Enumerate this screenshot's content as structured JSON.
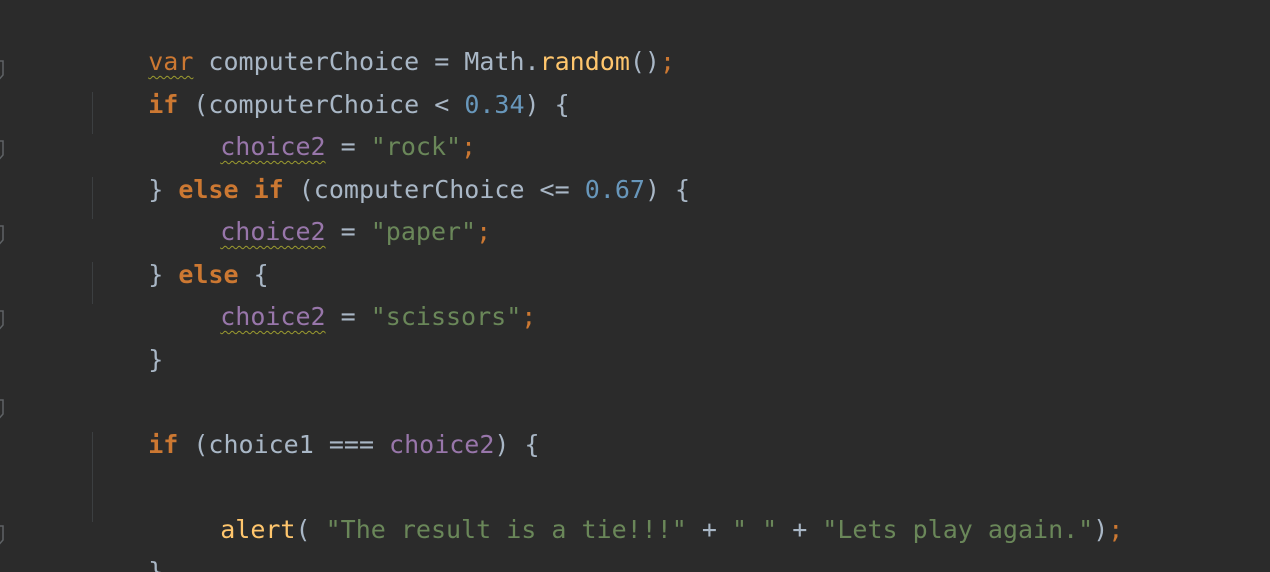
{
  "editor": {
    "theme_colors": {
      "background": "#2b2b2b",
      "keyword": "#cc7832",
      "number": "#6897bb",
      "string": "#6a8759",
      "variable": "#9876aa",
      "function": "#ffc66d",
      "plain": "#a9b7c6"
    },
    "code": {
      "l1_kw": "var",
      "l1_name": " computerChoice = Math.",
      "l1_fn": "random",
      "l1_tail": "()",
      "l1_semi": ";",
      "l2_kw": "if",
      "l2_open": " (computerChoice < ",
      "l2_num": "0.34",
      "l2_close": ") {",
      "l3_var": "choice2",
      "l3_eq": " = ",
      "l3_str": "\"rock\"",
      "l3_semi": ";",
      "l4_brace": "} ",
      "l4_kw": "else if",
      "l4_open": " (computerChoice <= ",
      "l4_num": "0.67",
      "l4_close": ") {",
      "l5_var": "choice2",
      "l5_eq": " = ",
      "l5_str": "\"paper\"",
      "l5_semi": ";",
      "l6_brace": "} ",
      "l6_kw": "else",
      "l6_close": " {",
      "l7_var": "choice2",
      "l7_eq": " = ",
      "l7_str": "\"scissors\"",
      "l7_semi": ";",
      "l8_brace": "}",
      "l10_kw": "if",
      "l10_open": " (choice1 === ",
      "l10_var": "choice2",
      "l10_close": ") {",
      "l12_fn": "alert",
      "l12_open": "( ",
      "l12_str1": "\"The result is a tie!!!\"",
      "l12_plus1": " + ",
      "l12_str2": "\" \"",
      "l12_plus2": " + ",
      "l12_str3": "\"Lets play again.\"",
      "l12_close": ")",
      "l12_semi": ";",
      "l13_brace": "}"
    }
  }
}
